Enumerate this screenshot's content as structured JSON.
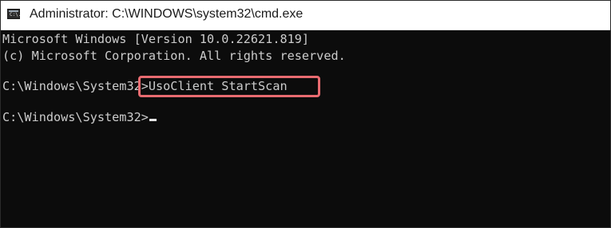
{
  "window": {
    "title": "Administrator: C:\\WINDOWS\\system32\\cmd.exe",
    "icon_text": "C:\\."
  },
  "console": {
    "lines": [
      "Microsoft Windows [Version 10.0.22621.819]",
      "(c) Microsoft Corporation. All rights reserved."
    ],
    "prompt1": "C:\\Windows\\System32>",
    "command": "UsoClient StartScan",
    "prompt2": "C:\\Windows\\System32>"
  },
  "colors": {
    "console_bg": "#0c0c0c",
    "console_text": "#cccccc",
    "highlight_border": "#e86b70"
  },
  "icons": [
    "cmd-app-icon"
  ]
}
